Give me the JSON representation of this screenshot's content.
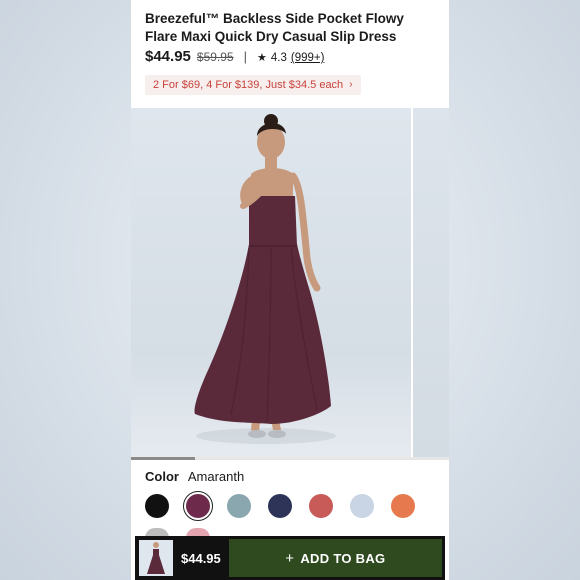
{
  "product": {
    "title": "Breezeful™ Backless Side Pocket Flowy Flare Maxi Quick Dry Casual Slip Dress",
    "price": "$44.95",
    "original_price": "$59.95",
    "separator": "|",
    "rating": "4.3",
    "reviews": "(999+)",
    "promo": "2 For $69, 4 For $139, Just $34.5 each",
    "promo_chevron": "›"
  },
  "gallery": {
    "image_progress": 0.2
  },
  "color": {
    "label": "Color",
    "selected": "Amaranth",
    "swatches": [
      "#111111",
      "#6e2a4b",
      "#8aa6ae",
      "#2e3458",
      "#c85a57",
      "#c9d5e4",
      "#e7794e"
    ],
    "partial_row": [
      "#bdbdbd",
      "#e5a5b0"
    ]
  },
  "bottom_bar": {
    "price": "$44.95",
    "add_to_bag": "ADD TO BAG",
    "plus_icon": "+"
  },
  "colors": {
    "dress": "#5a2a3b",
    "button": "#2e4a1e",
    "promo_text": "#c8433b"
  }
}
